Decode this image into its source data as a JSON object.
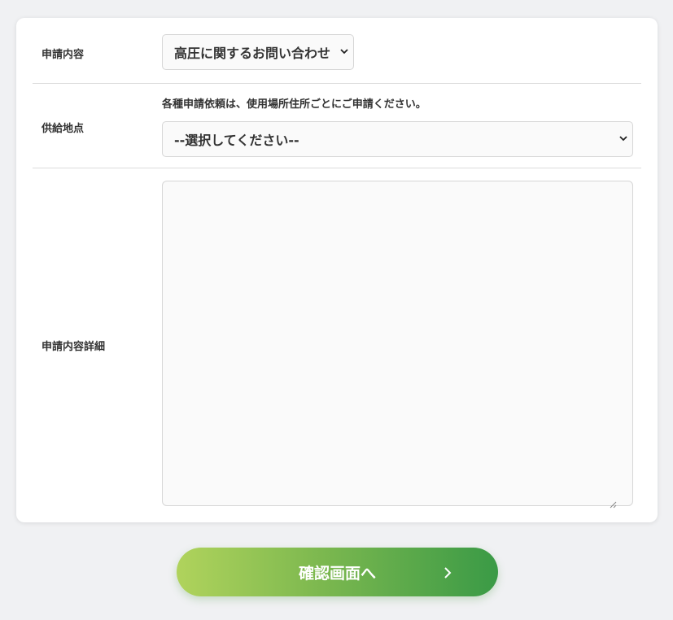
{
  "form": {
    "request_type": {
      "label": "申請内容",
      "selected": "高圧に関するお問い合わせ"
    },
    "supply_point": {
      "label": "供給地点",
      "note": "各種申請依頼は、使用場所住所ごとにご申請ください。",
      "selected": "--選択してください--"
    },
    "details": {
      "label": "申請内容詳細",
      "value": ""
    }
  },
  "submit": {
    "label": "確認画面へ"
  },
  "colors": {
    "accent_start": "#b0d35c",
    "accent_end": "#3a9a46"
  },
  "icons": {
    "select_chevron": "chevron-down-icon",
    "submit_arrow": "chevron-right-icon"
  }
}
